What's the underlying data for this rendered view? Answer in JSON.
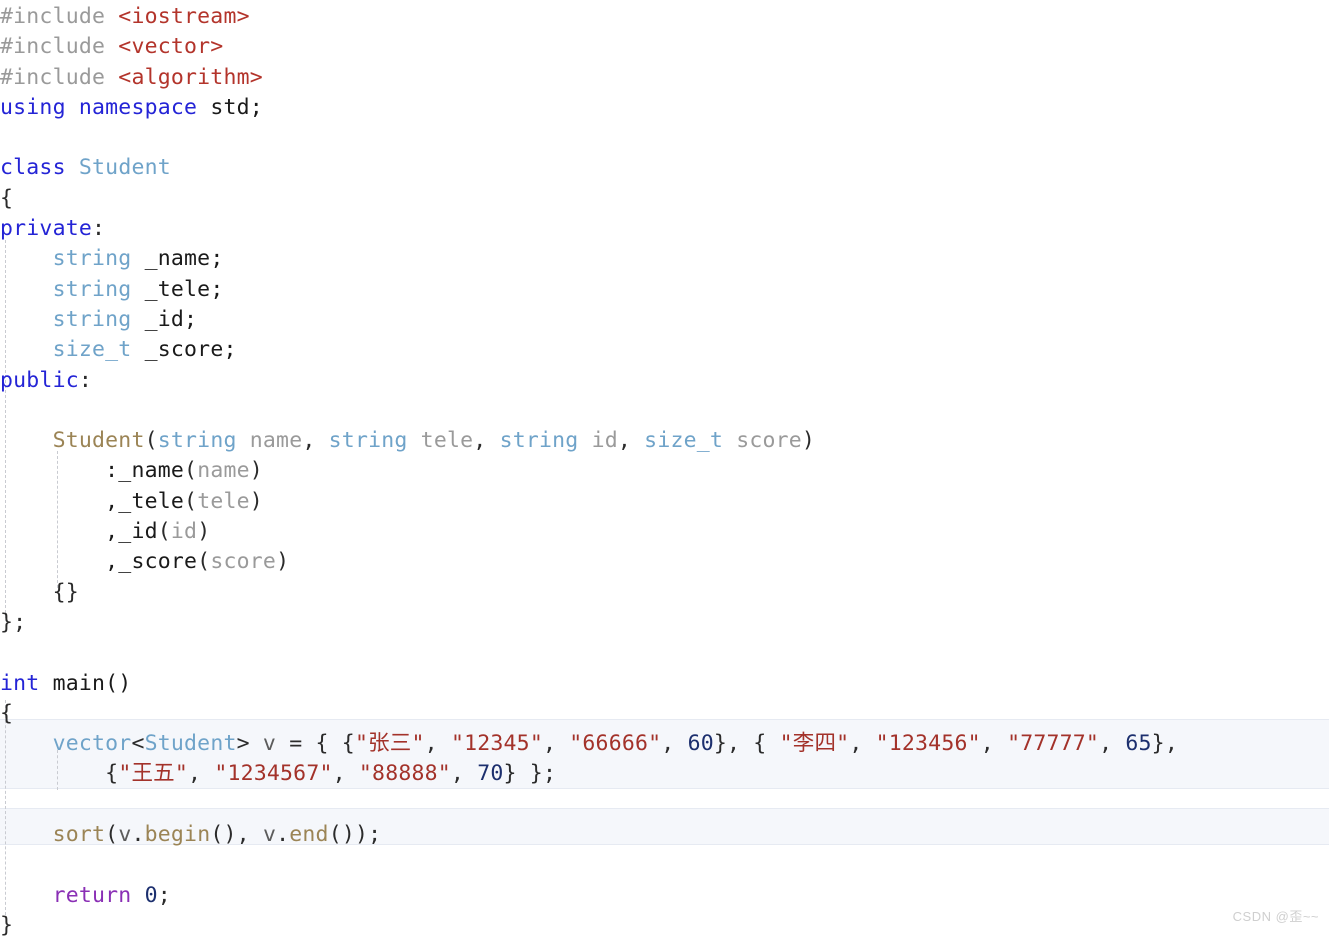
{
  "editor": {
    "language": "cpp",
    "background_color": "#ffffff",
    "highlight_color": "#f5f7fb",
    "highlight_border_color": "#e6eaf2",
    "indent_guide_color": "#c9cbd1",
    "line_height_px": 30,
    "font_size_px": 21
  },
  "palette": {
    "preprocessor": "#9a9a9a",
    "header_name": "#b3342b",
    "keyword": "#2424d6",
    "type": "#6fa3c9",
    "function": "#9b8455",
    "parameter": "#9a9a9a",
    "string": "#a3322a",
    "number": "#1c2f6e",
    "return_keyword": "#8a2fb5",
    "plain_text": "#1a1a1a",
    "variable": "#5c5c5c"
  },
  "code": {
    "lines": [
      {
        "n": 1,
        "text": "#include <iostream>"
      },
      {
        "n": 2,
        "text": "#include <vector>"
      },
      {
        "n": 3,
        "text": "#include <algorithm>"
      },
      {
        "n": 4,
        "text": "using namespace std;"
      },
      {
        "n": 5,
        "text": ""
      },
      {
        "n": 6,
        "text": "class Student"
      },
      {
        "n": 7,
        "text": "{"
      },
      {
        "n": 8,
        "text": "private:"
      },
      {
        "n": 9,
        "text": "    string _name;"
      },
      {
        "n": 10,
        "text": "    string _tele;"
      },
      {
        "n": 11,
        "text": "    string _id;"
      },
      {
        "n": 12,
        "text": "    size_t _score;"
      },
      {
        "n": 13,
        "text": "public:"
      },
      {
        "n": 14,
        "text": ""
      },
      {
        "n": 15,
        "text": "    Student(string name, string tele, string id, size_t score)"
      },
      {
        "n": 16,
        "text": "        :_name(name)"
      },
      {
        "n": 17,
        "text": "        ,_tele(tele)"
      },
      {
        "n": 18,
        "text": "        ,_id(id)"
      },
      {
        "n": 19,
        "text": "        ,_score(score)"
      },
      {
        "n": 20,
        "text": "    {}"
      },
      {
        "n": 21,
        "text": "};"
      },
      {
        "n": 22,
        "text": ""
      },
      {
        "n": 23,
        "text": "int main()"
      },
      {
        "n": 24,
        "text": "{"
      },
      {
        "n": 25,
        "text": "    vector<Student> v = { {\"张三\", \"12345\", \"66666\", 60}, { \"李四\", \"123456\", \"77777\", 65},"
      },
      {
        "n": 26,
        "text": "        {\"王五\", \"1234567\", \"88888\", 70} };"
      },
      {
        "n": 27,
        "text": ""
      },
      {
        "n": 28,
        "text": "    sort(v.begin(), v.end());"
      },
      {
        "n": 29,
        "text": ""
      },
      {
        "n": 30,
        "text": "    return 0;"
      },
      {
        "n": 31,
        "text": "}"
      }
    ],
    "tokens": {
      "l1": {
        "a": "#include ",
        "b": "<iostream>"
      },
      "l2": {
        "a": "#include ",
        "b": "<vector>"
      },
      "l3": {
        "a": "#include ",
        "b": "<algorithm>"
      },
      "l4": {
        "a": "using namespace",
        "b": " std;"
      },
      "l6": {
        "a": "class",
        "b": " ",
        "c": "Student"
      },
      "l7": {
        "a": "{"
      },
      "l8": {
        "a": "private",
        "b": ":"
      },
      "l9": {
        "indent": "    ",
        "a": "string",
        "b": " _name;"
      },
      "l10": {
        "indent": "    ",
        "a": "string",
        "b": " _tele;"
      },
      "l11": {
        "indent": "    ",
        "a": "string",
        "b": " _id;"
      },
      "l12": {
        "indent": "    ",
        "a": "size_t",
        "b": " _score;"
      },
      "l13": {
        "a": "public",
        "b": ":"
      },
      "l15": {
        "indent": "    ",
        "fn": "Student",
        "p1": "(",
        "t1": "string",
        "v1": " name",
        "s1": ", ",
        "t2": "string",
        "v2": " tele",
        "s2": ", ",
        "t3": "string",
        "v3": " id",
        "s3": ", ",
        "t4": "size_t",
        "v4": " score",
        "p2": ")"
      },
      "l16": {
        "indent": "        ",
        "a": ":_name",
        "b": "(",
        "c": "name",
        "d": ")"
      },
      "l17": {
        "indent": "        ",
        "a": ",_tele",
        "b": "(",
        "c": "tele",
        "d": ")"
      },
      "l18": {
        "indent": "        ",
        "a": ",_id",
        "b": "(",
        "c": "id",
        "d": ")"
      },
      "l19": {
        "indent": "        ",
        "a": ",_score",
        "b": "(",
        "c": "score",
        "d": ")"
      },
      "l20": {
        "indent": "    ",
        "a": "{}"
      },
      "l21": {
        "a": "};"
      },
      "l23": {
        "a": "int",
        "b": " main()"
      },
      "l24": {
        "a": "{"
      },
      "l25": {
        "indent": "    ",
        "t": "vector",
        "lt": "<",
        "cls": "Student",
        "gt": "> ",
        "v": "v",
        "eq": " = { {",
        "s1": "\"张三\"",
        "c1": ", ",
        "s2": "\"12345\"",
        "c2": ", ",
        "s3": "\"66666\"",
        "c3": ", ",
        "n1": "60",
        "c4": "}, { ",
        "s4": "\"李四\"",
        "c5": ", ",
        "s5": "\"123456\"",
        "c6": ", ",
        "s6": "\"77777\"",
        "c7": ", ",
        "n2": "65",
        "c8": "},"
      },
      "l26": {
        "indent": "        ",
        "o": "{",
        "s1": "\"王五\"",
        "c1": ", ",
        "s2": "\"1234567\"",
        "c2": ", ",
        "s3": "\"88888\"",
        "c3": ", ",
        "n1": "70",
        "end": "} };"
      },
      "l28": {
        "indent": "    ",
        "fn": "sort",
        "p1": "(",
        "v1": "v",
        "dot1": ".",
        "m1": "begin",
        "pp1": "(), ",
        "v2": "v",
        "dot2": ".",
        "m2": "end",
        "pp2": "())",
        "semi": ";"
      },
      "l30": {
        "indent": "    ",
        "a": "return",
        "b": " ",
        "c": "0",
        "d": ";"
      },
      "l31": {
        "a": "}"
      }
    }
  },
  "highlighted_lines": [
    25,
    26,
    28
  ],
  "watermark": {
    "text": "CSDN @歪~~"
  }
}
